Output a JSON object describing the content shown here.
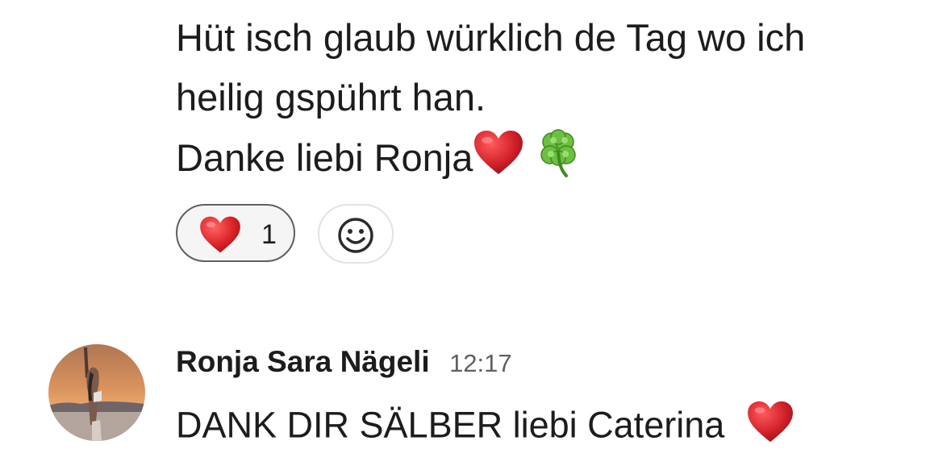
{
  "message": {
    "lines": [
      "Hüt isch glaub würklich de Tag wo ich",
      "heilig gspührt han.",
      "Danke liebi Ronja"
    ],
    "trailing_emojis": [
      "red-heart",
      "four-leaf-clover"
    ]
  },
  "reactions": [
    {
      "emoji": "red-heart",
      "count": "1"
    }
  ],
  "add_reaction": {
    "icon": "smiley-add-icon"
  },
  "reply": {
    "author": "Ronja Sara Nägeli",
    "time": "12:17",
    "text": "DANK DIR SÄLBER liebi Caterina",
    "trailing_emoji": "red-heart"
  },
  "colors": {
    "text": "#1d1c1d",
    "timestamp": "#616061",
    "pill_border": "#5f5f5f",
    "heart": "#d2202a"
  }
}
